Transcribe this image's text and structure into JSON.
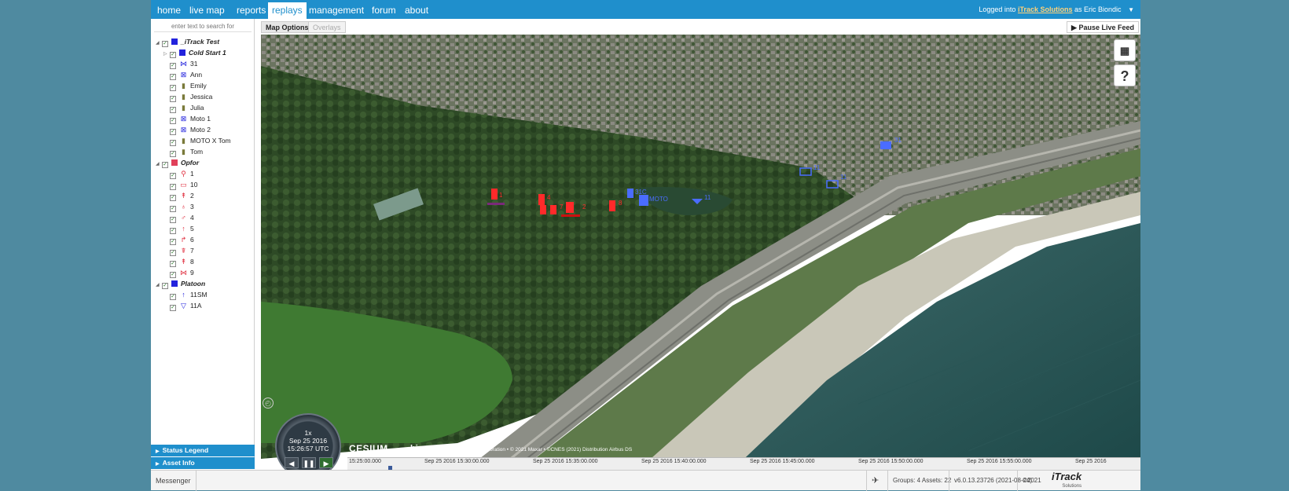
{
  "nav": {
    "items": [
      "home",
      "live map",
      "reports",
      "replays",
      "management",
      "forum",
      "about"
    ],
    "active": "replays",
    "logged_prefix": "Logged into",
    "org": "iTrack Solutions",
    "as": "as",
    "user": "Eric Biondic"
  },
  "search": {
    "placeholder": "enter text to search for"
  },
  "tree": {
    "groups": [
      {
        "name": "_iTrack Test",
        "color": "#2222dd"
      },
      {
        "name": "Cold Start 1",
        "color": "#2222dd"
      },
      {
        "name": "Opfor",
        "color": "#e0405a"
      },
      {
        "name": "Platoon",
        "color": "#2222dd"
      }
    ],
    "itrack_items": [
      "31",
      "Ann",
      "Emily",
      "Jessica",
      "Julia",
      "Moto 1",
      "Moto 2",
      "MOTO X Tom",
      "Tom"
    ],
    "opfor_items": [
      "1",
      "10",
      "2",
      "3",
      "4",
      "5",
      "6",
      "7",
      "8",
      "9"
    ],
    "platoon_items": [
      "11SM",
      "11A"
    ]
  },
  "panels": {
    "status_legend": "Status Legend",
    "asset_info": "Asset Info"
  },
  "map_toolbar": {
    "map_options": "Map Options",
    "overlays": "Overlays",
    "pause": "Pause Live Feed"
  },
  "map_controls": {
    "help": "?"
  },
  "clock": {
    "speed": "1x",
    "date": "Sep 25 2016",
    "time": "15:26:57 UTC"
  },
  "credits": {
    "cesium": "CESIUM",
    "bing": "bing",
    "text": "© 2021 Microsoft Corporation • © 2021 Maxar • ©CNES (2021) Distribution Airbus DS"
  },
  "timeline": {
    "labels": [
      "15:25:00.000",
      "Sep 25 2016 15:30:00.000",
      "Sep 25 2016 15:35:00.000",
      "Sep 25 2016 15:40:00.000",
      "Sep 25 2016 15:45:00.000",
      "Sep 25 2016 15:50:00.000",
      "Sep 25 2016 15:55:00.000",
      "Sep 25 2016"
    ]
  },
  "map_labels": {
    "opfor": [
      "1",
      "4",
      "7",
      "2",
      "8"
    ],
    "blue": [
      "31C",
      "MOTO",
      "11",
      "11",
      "11",
      "31"
    ]
  },
  "footer": {
    "messenger": "Messenger",
    "counts": "Groups: 4 Assets: 22",
    "version": "v6.0.13.23726 (2021-08-24)",
    "copyright": "©2021",
    "logo": "iTrack",
    "logo_sub": "Solutions"
  }
}
